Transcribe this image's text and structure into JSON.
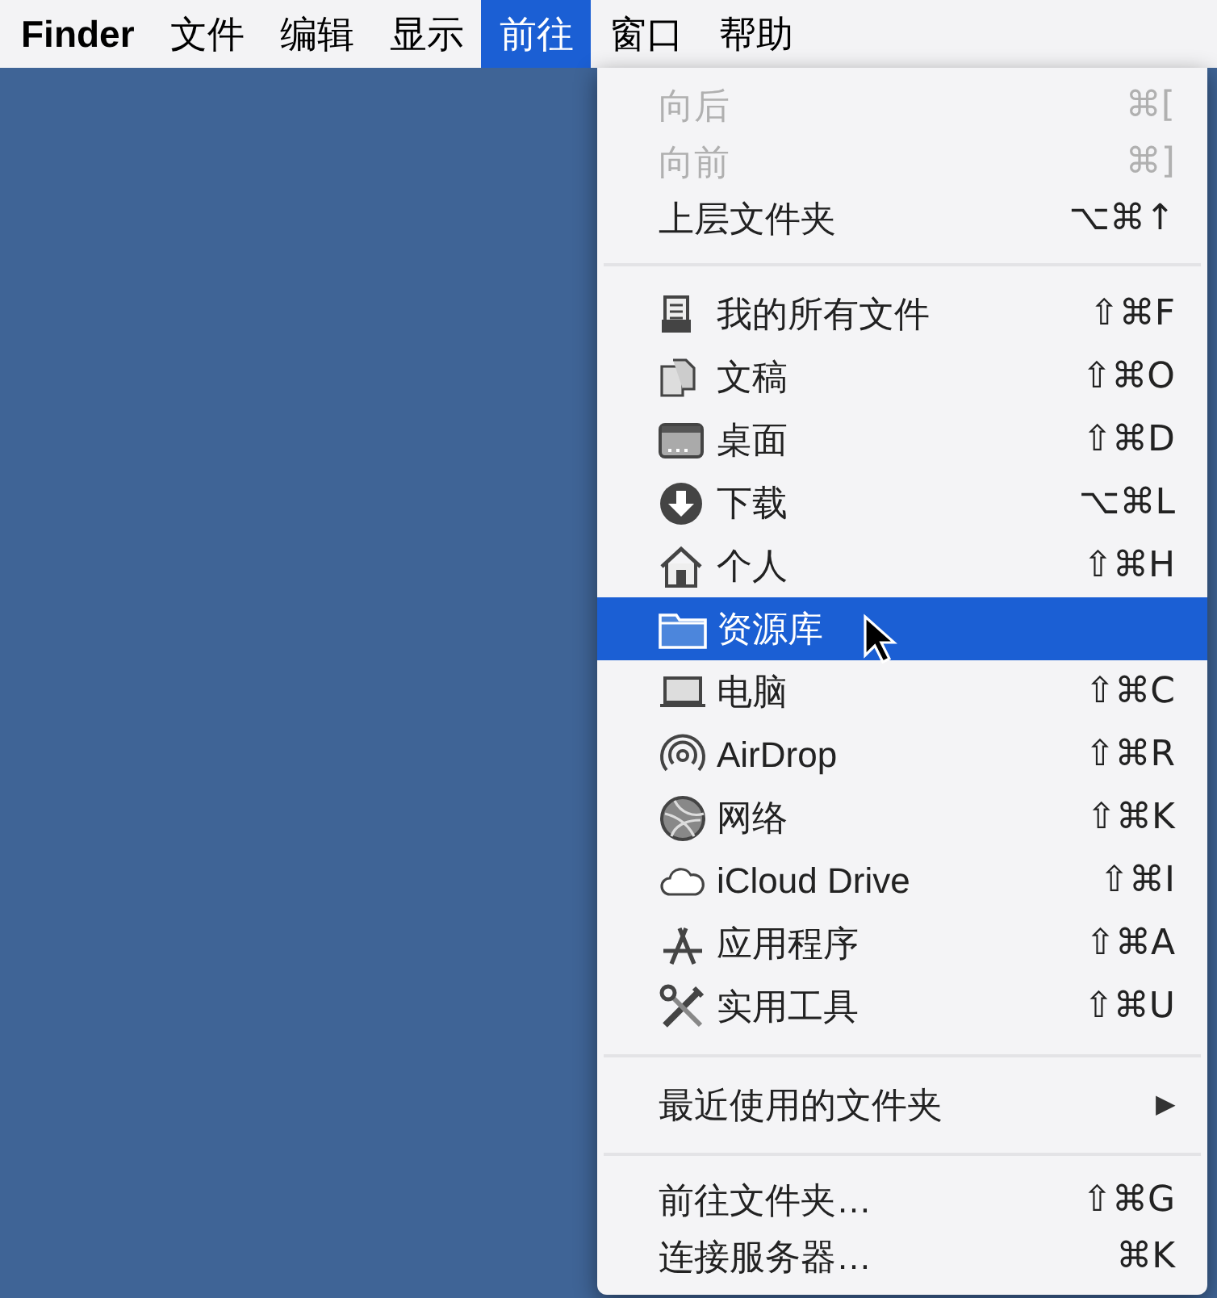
{
  "menu_bar": [
    {
      "label": "Finder",
      "selected": false
    },
    {
      "label": "文件",
      "selected": false
    },
    {
      "label": "编辑",
      "selected": false
    },
    {
      "label": "显示",
      "selected": false
    },
    {
      "label": "前往",
      "selected": true
    },
    {
      "label": "窗口",
      "selected": false
    },
    {
      "label": "帮助",
      "selected": false
    }
  ],
  "go_menu": {
    "sections": [
      {
        "items": [
          {
            "kind": "plain",
            "label": "向后",
            "shortcut": "⌘[",
            "disabled": true,
            "selected": false
          },
          {
            "kind": "plain",
            "label": "向前",
            "shortcut": "⌘]",
            "disabled": true,
            "selected": false
          },
          {
            "kind": "plain",
            "label": "上层文件夹",
            "shortcut": "⌥⌘↑",
            "disabled": false,
            "selected": false
          }
        ]
      },
      {
        "items": [
          {
            "kind": "place",
            "label": "我的所有文件",
            "shortcut": "⇧⌘F",
            "disabled": false,
            "selected": false
          },
          {
            "kind": "place",
            "label": "文稿",
            "shortcut": "⇧⌘O",
            "disabled": false,
            "selected": false
          },
          {
            "kind": "place",
            "label": "桌面",
            "shortcut": "⇧⌘D",
            "disabled": false,
            "selected": false
          },
          {
            "kind": "place",
            "label": "下载",
            "shortcut": "⌥⌘L",
            "disabled": false,
            "selected": false
          },
          {
            "kind": "place",
            "label": "个人",
            "shortcut": "⇧⌘H",
            "disabled": false,
            "selected": false
          },
          {
            "kind": "place",
            "label": "资源库",
            "disabled": false,
            "selected": true
          },
          {
            "kind": "place",
            "label": "电脑",
            "shortcut": "⇧⌘C",
            "disabled": false,
            "selected": false
          },
          {
            "kind": "place",
            "label": "AirDrop",
            "shortcut": "⇧⌘R",
            "disabled": false,
            "selected": false
          },
          {
            "kind": "place",
            "label": "网络",
            "shortcut": "⇧⌘K",
            "disabled": false,
            "selected": false
          },
          {
            "kind": "place",
            "label": "iCloud Drive",
            "shortcut": "⇧⌘I",
            "disabled": false,
            "selected": false
          },
          {
            "kind": "place",
            "label": "应用程序",
            "shortcut": "⇧⌘A",
            "disabled": false,
            "selected": false
          },
          {
            "kind": "place",
            "label": "实用工具",
            "shortcut": "⇧⌘U",
            "disabled": false,
            "selected": false
          }
        ]
      },
      {
        "items": [
          {
            "kind": "plain",
            "label": "最近使用的文件夹",
            "submenu_arrow": "▶",
            "disabled": false,
            "selected": false
          }
        ]
      },
      {
        "items": [
          {
            "kind": "plain",
            "label": "前往文件夹…",
            "shortcut": "⇧⌘G",
            "disabled": false,
            "selected": false
          },
          {
            "kind": "plain",
            "label": "连接服务器…",
            "shortcut": "⌘K",
            "disabled": false,
            "selected": false
          }
        ]
      }
    ]
  }
}
